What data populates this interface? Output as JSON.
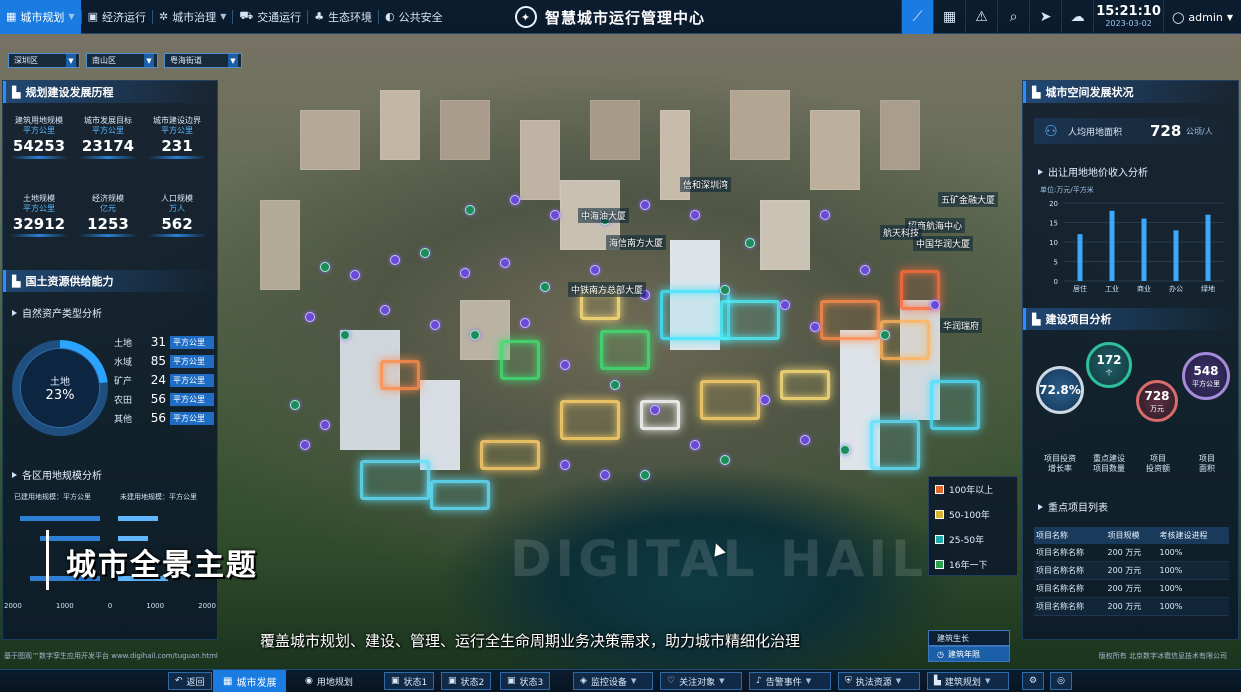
{
  "colors": {
    "accent": "#1a7be0",
    "panel_bg": "#0a182a",
    "value_blue": "#58b7ff"
  },
  "topnav": {
    "items": [
      {
        "label": "城市规划",
        "icon": "city-icon",
        "active": true,
        "dropdown": true
      },
      {
        "label": "经济运行",
        "icon": "economy-icon",
        "active": false,
        "dropdown": false
      },
      {
        "label": "城市治理",
        "icon": "governance-icon",
        "active": false,
        "dropdown": true
      },
      {
        "label": "交通运行",
        "icon": "traffic-icon",
        "active": false,
        "dropdown": false
      },
      {
        "label": "生态环境",
        "icon": "ecology-icon",
        "active": false,
        "dropdown": false
      },
      {
        "label": "公共安全",
        "icon": "safety-icon",
        "active": false,
        "dropdown": false
      }
    ],
    "title": "智慧城市运行管理中心",
    "tools": [
      "chart-icon",
      "grid-icon",
      "alert-icon",
      "search-icon",
      "send-icon",
      "cloud-icon"
    ],
    "time": "15:21:10",
    "date": "2023-03-02",
    "user": "admin"
  },
  "selects": [
    {
      "value": "深圳区"
    },
    {
      "value": "南山区"
    },
    {
      "value": "粤海街道"
    }
  ],
  "left": {
    "history_title": "规划建设发展历程",
    "stats": [
      {
        "label": "建筑用地规模",
        "unit": "平方公里",
        "value": "54253"
      },
      {
        "label": "城市发展目标",
        "unit": "平方公里",
        "value": "23174"
      },
      {
        "label": "城市建设边界",
        "unit": "平方公里",
        "value": "231"
      },
      {
        "label": "土地规模",
        "unit": "平方公里",
        "value": "32912"
      },
      {
        "label": "经济规模",
        "unit": "亿元",
        "value": "1253"
      },
      {
        "label": "人口规模",
        "unit": "万人",
        "value": "562"
      }
    ],
    "supply_title": "国土资源供给能力",
    "asset_title": "自然资产类型分析",
    "donut": {
      "label": "土地",
      "value": "23%",
      "fraction": 0.23
    },
    "resources": [
      {
        "name": "土地",
        "value": "31",
        "unit": "平方公里"
      },
      {
        "name": "水域",
        "value": "85",
        "unit": "平方公里"
      },
      {
        "name": "矿产",
        "value": "24",
        "unit": "平方公里"
      },
      {
        "name": "农田",
        "value": "56",
        "unit": "平方公里"
      },
      {
        "name": "其他",
        "value": "56",
        "unit": "平方公里"
      }
    ],
    "district_title": "各区用地规模分析",
    "district_left_label": "已建用地规模：平方公里",
    "district_right_label": "未建用地规模：平方公里",
    "axis_ticks": [
      "2000",
      "1000",
      "0",
      "1000",
      "2000"
    ]
  },
  "right": {
    "space_title": "城市空间发展状况",
    "kpi": {
      "label": "人均用地面积",
      "value": "728",
      "unit": "公顷/人"
    },
    "income_title": "出让用地地价收入分析",
    "chart_unit": "单位:万元/平方米",
    "chart_data": {
      "type": "bar",
      "categories": [
        "居住",
        "工业",
        "商业",
        "办公",
        "绿地"
      ],
      "values": [
        12,
        18,
        16,
        13,
        17
      ],
      "ylim": [
        0,
        20
      ],
      "yticks": [
        "0",
        "5",
        "10",
        "15",
        "20"
      ]
    },
    "project_title": "建设项目分析",
    "bubbles": [
      {
        "value": "72.8%",
        "unit": "",
        "label1": "项目投资",
        "label2": "增长率"
      },
      {
        "value": "172",
        "unit": "个",
        "label1": "重点建设",
        "label2": "项目数量"
      },
      {
        "value": "728",
        "unit": "万元",
        "label1": "项目",
        "label2": "投资额"
      },
      {
        "value": "548",
        "unit": "平方公里",
        "label1": "项目",
        "label2": "面积"
      }
    ],
    "list_title": "重点项目列表",
    "table": {
      "headers": [
        "项目名称",
        "项目规模",
        "考核建设进程"
      ],
      "rows": [
        [
          "项目名称名称",
          "200 万元",
          "100%"
        ],
        [
          "项目名称名称",
          "200 万元",
          "100%"
        ],
        [
          "项目名称名称",
          "200 万元",
          "100%"
        ],
        [
          "项目名称名称",
          "200 万元",
          "100%"
        ]
      ]
    }
  },
  "map": {
    "labels": [
      "信和深圳湾",
      "中海油大厦",
      "五矿金融大厦",
      "海信南方大厦",
      "招商航海中心",
      "航天科技",
      "中国华润大厦",
      "中铁南方总部大厦",
      "华润瑞府"
    ],
    "watermark": "DIGITAL HAIL",
    "legend": [
      {
        "label": "100年以上",
        "color": "#e0672b"
      },
      {
        "label": "50-100年",
        "color": "#d8b531"
      },
      {
        "label": "25-50年",
        "color": "#21a9a7"
      },
      {
        "label": "16年一下",
        "color": "#2aa14a"
      }
    ],
    "toggles": [
      {
        "label": "建筑生长",
        "on": false
      },
      {
        "label": "建筑年限",
        "on": true
      }
    ]
  },
  "overlay": {
    "theme": "城市全景主题",
    "subtitle": "覆盖城市规划、建设、管理、运行全生命周期业务决策需求，助力城市精细化治理",
    "copyright_left": "基于图观™数字孪生应用开发平台 www.digihail.com/tuguan.html",
    "copyright_right": "版权所有 北京数字冰雹信息技术有限公司"
  },
  "bottombar": {
    "back": "返回",
    "tabs": [
      "城市发展",
      "用地规划"
    ],
    "states": [
      "状态1",
      "状态2",
      "状态3"
    ],
    "dropdowns": [
      "监控设备",
      "关注对象",
      "告警事件",
      "执法资源",
      "建筑规划"
    ]
  }
}
